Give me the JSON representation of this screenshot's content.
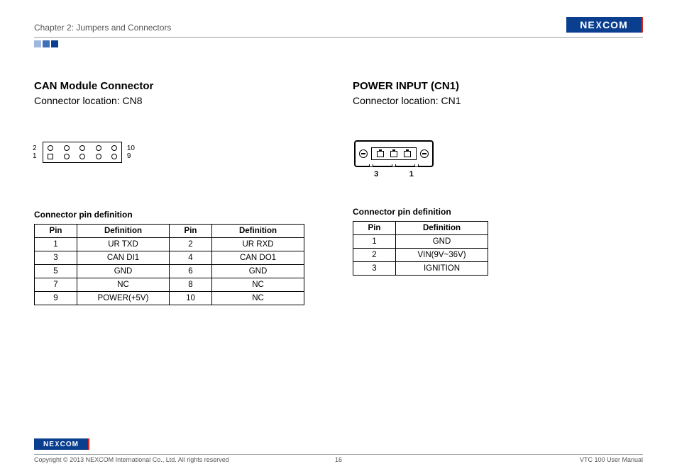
{
  "header": {
    "chapter": "Chapter 2: Jumpers and Connectors",
    "logo_text": "NEXCOM"
  },
  "left": {
    "title": "CAN Module Connector",
    "subtitle": "Connector location: CN8",
    "diagram_labels": {
      "top_left": "2",
      "bot_left": "1",
      "top_right": "10",
      "bot_right": "9"
    },
    "table_label": "Connector pin definition",
    "table_headers": [
      "Pin",
      "Definition",
      "Pin",
      "Definition"
    ],
    "rows": [
      [
        "1",
        "UR TXD",
        "2",
        "UR RXD"
      ],
      [
        "3",
        "CAN DI1",
        "4",
        "CAN DO1"
      ],
      [
        "5",
        "GND",
        "6",
        "GND"
      ],
      [
        "7",
        "NC",
        "8",
        "NC"
      ],
      [
        "9",
        "POWER(+5V)",
        "10",
        "NC"
      ]
    ]
  },
  "right": {
    "title": "POWER INPUT (CN1)",
    "subtitle": "Connector location: CN1",
    "diagram_labels": {
      "l1": "3",
      "l2": "1"
    },
    "table_label": "Connector pin definition",
    "table_headers": [
      "Pin",
      "Definition"
    ],
    "rows": [
      [
        "1",
        "GND"
      ],
      [
        "2",
        "VIN(9V~36V)"
      ],
      [
        "3",
        "IGNITION"
      ]
    ]
  },
  "footer": {
    "copyright": "Copyright © 2013 NEXCOM International Co., Ltd. All rights reserved",
    "page": "16",
    "doc": "VTC 100 User Manual",
    "logo_text": "NEXCOM"
  }
}
